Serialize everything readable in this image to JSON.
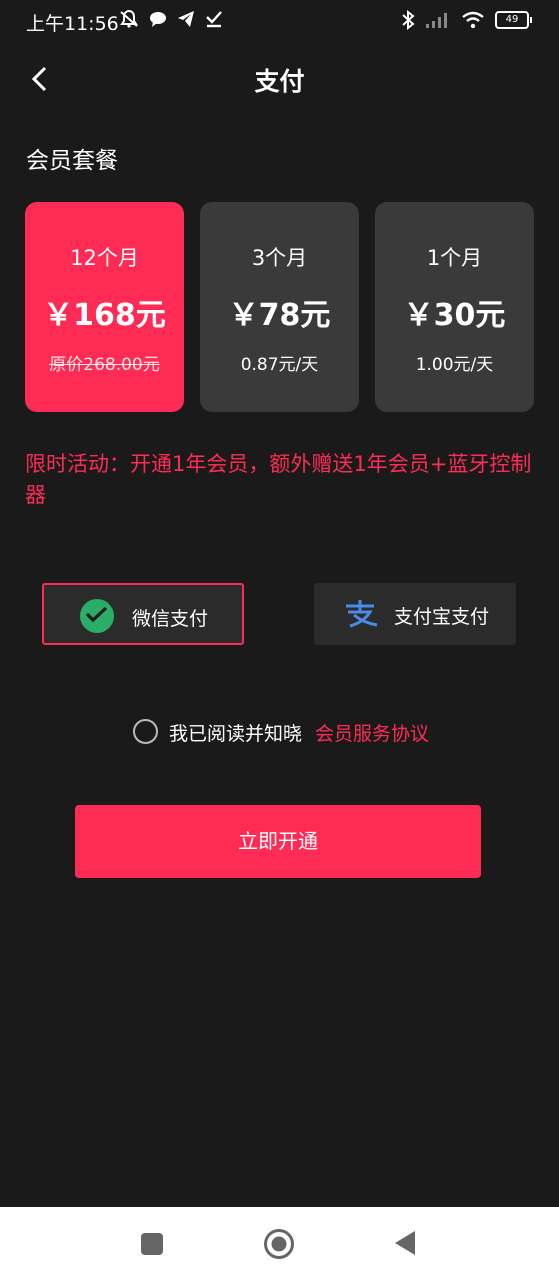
{
  "status_bar": {
    "time": "上午11:56",
    "battery": "49",
    "icons": [
      "mute-bell-icon",
      "chat-bubble-icon",
      "telegram-icon",
      "download-check-icon",
      "bluetooth-icon",
      "signal-icon",
      "wifi-icon",
      "battery-icon"
    ]
  },
  "header": {
    "title": "支付",
    "back_icon": "chevron-left-icon"
  },
  "membership": {
    "section_title": "会员套餐",
    "plans": [
      {
        "name": "12个月",
        "price": "￥168元",
        "sub": "原价268.00元",
        "selected": true
      },
      {
        "name": "3个月",
        "price": "￥78元",
        "sub": "0.87元/天",
        "selected": false
      },
      {
        "name": "1个月",
        "price": "￥30元",
        "sub": "1.00元/天",
        "selected": false
      }
    ]
  },
  "promo": "限时活动：开通1年会员，额外赠送1年会员+蓝牙控制器",
  "payment": {
    "options": [
      {
        "label": "微信支付",
        "icon": "wechat-icon",
        "selected": true
      },
      {
        "label": "支付宝支付",
        "icon": "alipay-icon",
        "selected": false
      }
    ]
  },
  "agreement": {
    "text": "我已阅读并知晓",
    "link": "会员服务协议"
  },
  "submit_label": "立即开通",
  "colors": {
    "accent": "#fe2c55",
    "background": "#1a1a1a",
    "card": "#3a3a3a",
    "wechat": "#2aae67",
    "alipay": "#4a8be8"
  }
}
